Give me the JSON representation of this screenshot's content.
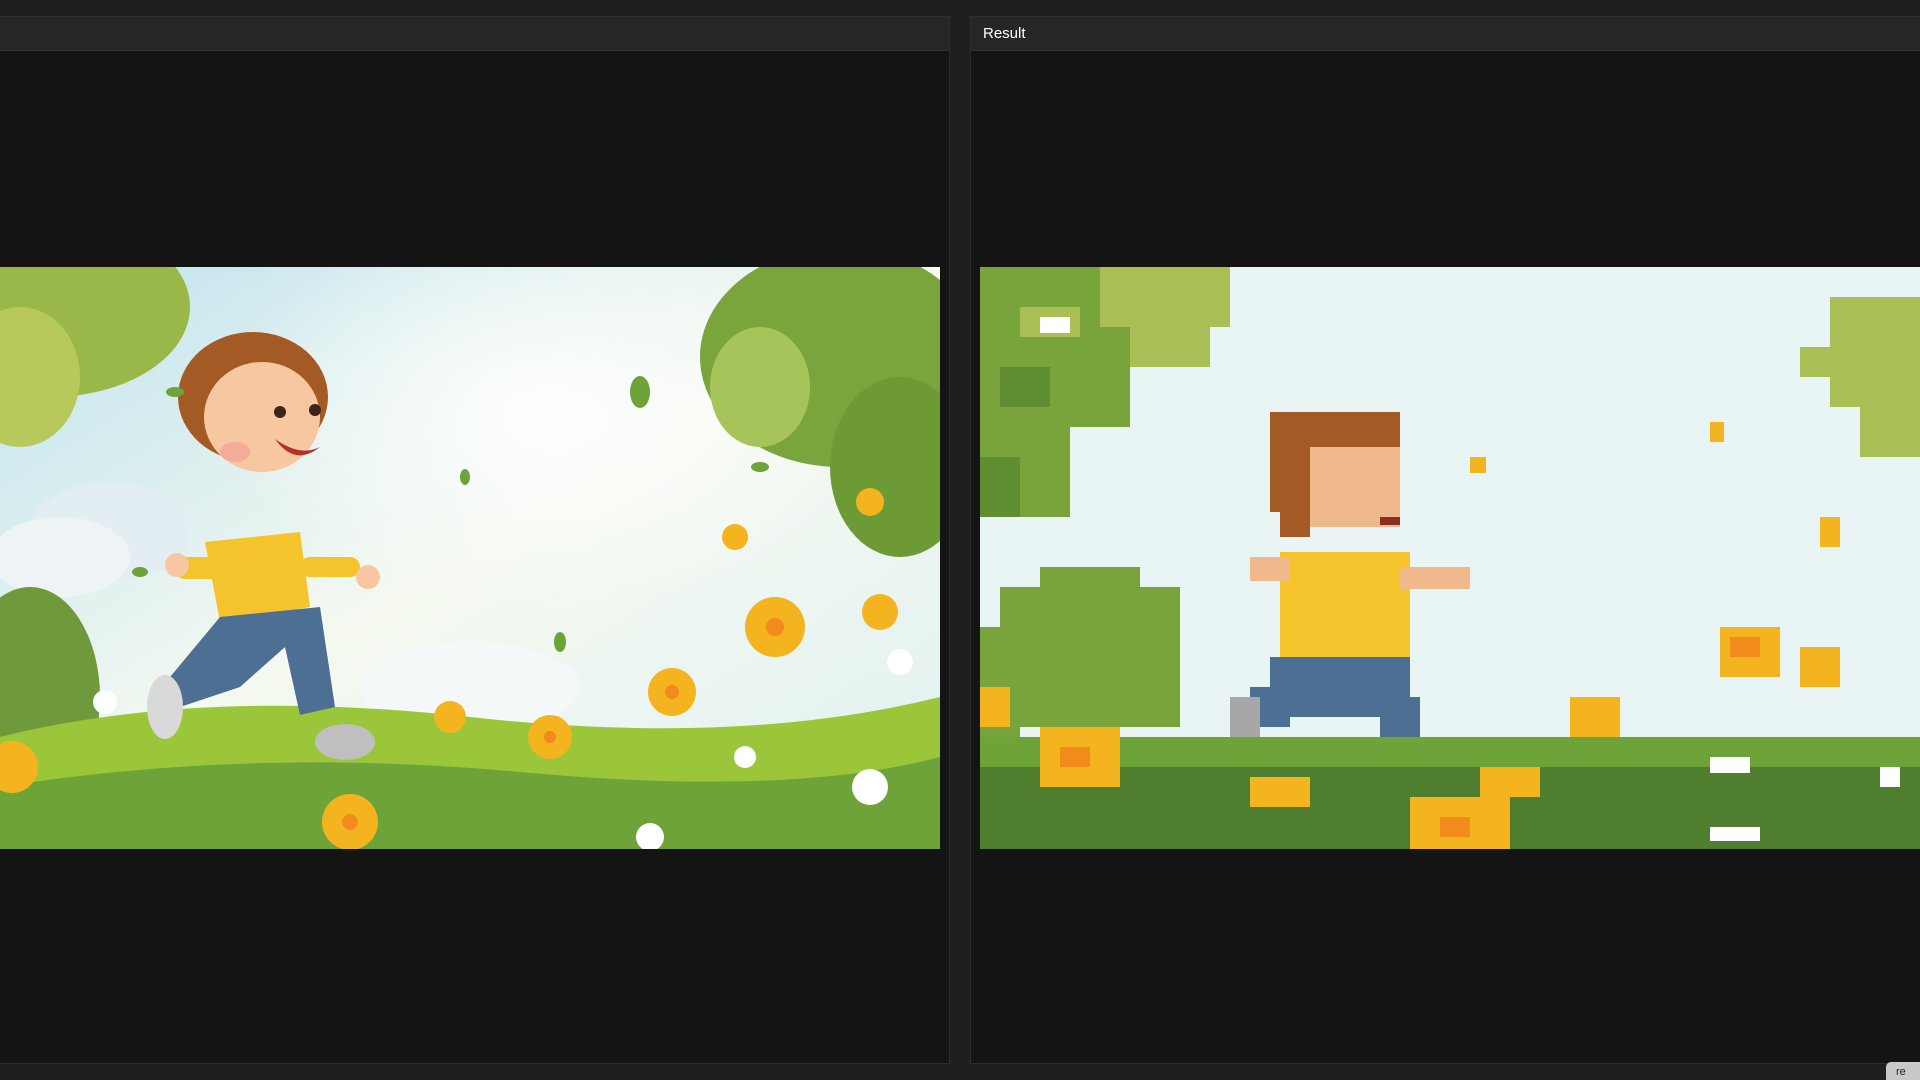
{
  "panels": {
    "left": {
      "title": ""
    },
    "right": {
      "title": "Result"
    }
  },
  "corner_badge": {
    "label": "re"
  },
  "colors": {
    "sky": "#e9f5f4",
    "grass": "#6ea33a",
    "flower": "#f4b41f",
    "shirt": "#f5c42c",
    "jeans": "#4c6f93",
    "hair": "#a45a24",
    "foliage": "#78a43b"
  }
}
